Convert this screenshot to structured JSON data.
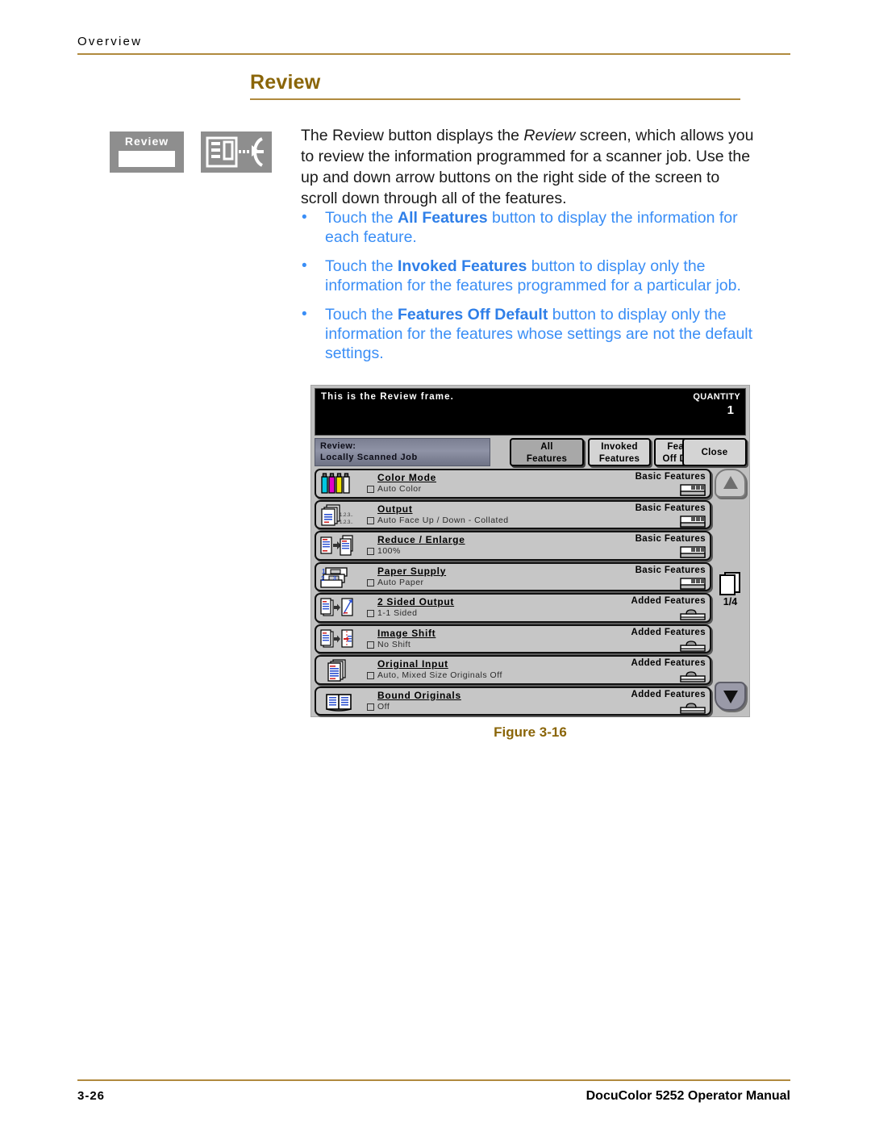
{
  "running_head": "Overview",
  "section": {
    "title": "Review"
  },
  "margin_icons": {
    "review_button_label": "Review",
    "review_button_icon": "review-button-icon",
    "review_doc_icon": "document-review-icon"
  },
  "body": {
    "paragraph_part1": "The Review button displays the ",
    "paragraph_italic": "Review",
    "paragraph_part2": " screen, which allows you to review the information programmed for a scanner job. Use the up and down arrow buttons on the right side of the screen to scroll down through all of the features.",
    "bullet_marker": "•",
    "bullets": [
      {
        "pre": "Touch the ",
        "bold": "All Features",
        "post": " button to display the information for each feature."
      },
      {
        "pre": "Touch the ",
        "bold": "Invoked Features",
        "post": " button to display only the information for the features programmed for a particular job."
      },
      {
        "pre": "Touch the ",
        "bold": "Features Off Default",
        "post": " button to display only the information for the features whose settings are not the default settings."
      }
    ]
  },
  "figure": {
    "caption": "Figure 3-16",
    "screen": {
      "message": "This is the Review frame.",
      "quantity_label": "QUANTITY",
      "quantity_value": "1",
      "job_title_line1": "Review:",
      "job_title_line2": "Locally Scanned Job",
      "tabs": [
        {
          "line1": "All",
          "line2": "Features",
          "selected": true
        },
        {
          "line1": "Invoked",
          "line2": "Features",
          "selected": false
        },
        {
          "line1": "Features",
          "line2": "Off Default",
          "selected": false
        },
        {
          "line1": "Close",
          "line2": "",
          "selected": false
        }
      ],
      "features": [
        {
          "icon": "toner-bottles-icon",
          "name": "Color Mode",
          "value": "Auto Color",
          "category": "Basic Features"
        },
        {
          "icon": "output-stack-icon",
          "name": "Output",
          "value": "Auto Face Up / Down - Collated",
          "category": "Basic Features"
        },
        {
          "icon": "reduce-enlarge-icon",
          "name": "Reduce / Enlarge",
          "value": "100%",
          "category": "Basic Features"
        },
        {
          "icon": "paper-trays-icon",
          "name": "Paper Supply",
          "value": "Auto Paper",
          "category": "Basic Features"
        },
        {
          "icon": "two-sided-icon",
          "name": "2 Sided Output",
          "value": "1-1 Sided",
          "category": "Added Features"
        },
        {
          "icon": "image-shift-icon",
          "name": "Image Shift",
          "value": "No Shift",
          "category": "Added Features"
        },
        {
          "icon": "original-input-icon",
          "name": "Original Input",
          "value": "Auto, Mixed Size Originals Off",
          "category": "Added Features"
        },
        {
          "icon": "bound-originals-icon",
          "name": "Bound Originals",
          "value": "Off",
          "category": "Added Features"
        }
      ],
      "scroll": {
        "up_icon": "scroll-up-arrow-icon",
        "down_icon": "scroll-down-arrow-icon",
        "page_icon": "page-stack-icon",
        "page_indicator": "1/4"
      }
    }
  },
  "footer": {
    "page_number": "3-26",
    "manual_title": "DocuColor 5252 Operator Manual"
  },
  "colors": {
    "accent_gold": "#8a6508",
    "rule_gold": "#b08a3e",
    "bullet_blue": "#3a8ef6",
    "panel_gray": "#c0c0c0"
  }
}
